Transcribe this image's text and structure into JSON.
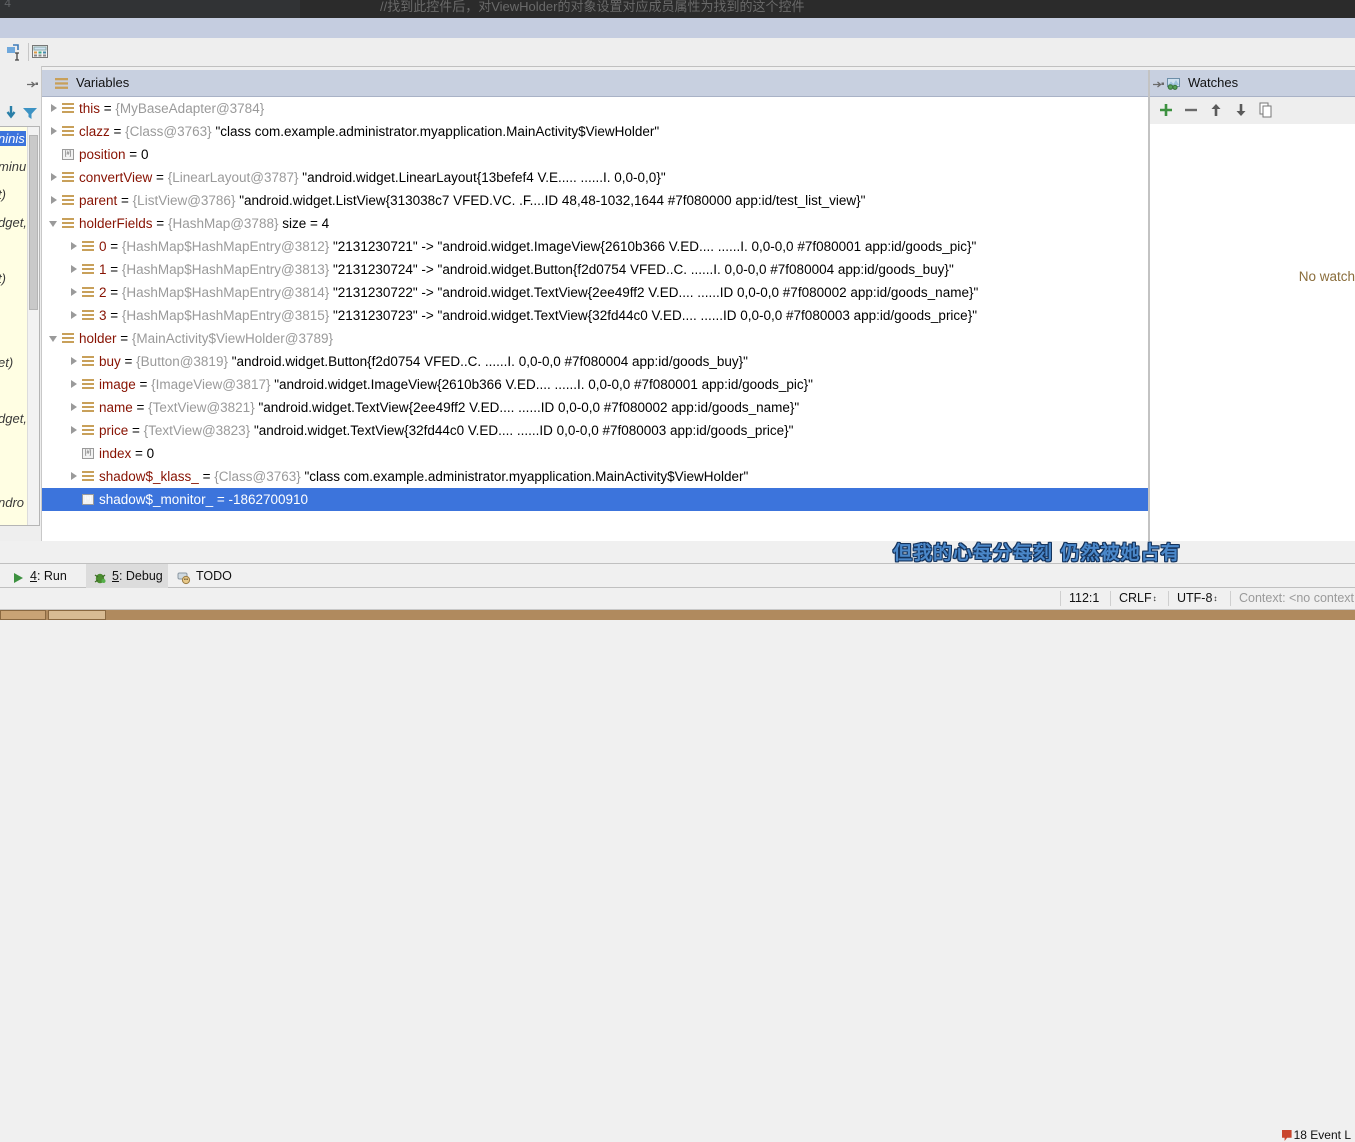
{
  "editor": {
    "line_number": "4",
    "comment": "//找到此控件后，对ViewHolder的对象设置对应成员属性为找到的这个控件"
  },
  "mini_toolbar": {
    "icons": [
      "evaluate-expression-icon",
      "calculator-icon"
    ]
  },
  "variables_panel": {
    "title": "Variables",
    "icon": "variables-icon",
    "rows": [
      {
        "indent": 0,
        "toggle": "right",
        "icon": "obj",
        "name": "this",
        "eq": " = ",
        "type": "{MyBaseAdapter@3784}",
        "value": ""
      },
      {
        "indent": 0,
        "toggle": "right",
        "icon": "obj",
        "name": "clazz",
        "eq": " = ",
        "type": "{Class@3763}",
        "value": "\"class com.example.administrator.myapplication.MainActivity$ViewHolder\""
      },
      {
        "indent": 0,
        "toggle": "none",
        "icon": "prim",
        "name": "position",
        "eq": " = ",
        "type": "",
        "value": "0"
      },
      {
        "indent": 0,
        "toggle": "right",
        "icon": "obj",
        "name": "convertView",
        "eq": " = ",
        "type": "{LinearLayout@3787}",
        "value": "\"android.widget.LinearLayout{13befef4 V.E..... ......I. 0,0-0,0}\""
      },
      {
        "indent": 0,
        "toggle": "right",
        "icon": "obj",
        "name": "parent",
        "eq": " = ",
        "type": "{ListView@3786}",
        "value": "\"android.widget.ListView{313038c7 VFED.VC. .F....ID 48,48-1032,1644 #7f080000 app:id/test_list_view}\""
      },
      {
        "indent": 0,
        "toggle": "down",
        "icon": "obj",
        "name": "holderFields",
        "eq": " = ",
        "type": "{HashMap@3788}",
        "value": "size = 4"
      },
      {
        "indent": 1,
        "toggle": "right",
        "icon": "obj",
        "name": "0",
        "eq": " = ",
        "type": "{HashMap$HashMapEntry@3812}",
        "value": "\"2131230721\" -> \"android.widget.ImageView{2610b366 V.ED.... ......I. 0,0-0,0 #7f080001 app:id/goods_pic}\""
      },
      {
        "indent": 1,
        "toggle": "right",
        "icon": "obj",
        "name": "1",
        "eq": " = ",
        "type": "{HashMap$HashMapEntry@3813}",
        "value": "\"2131230724\" -> \"android.widget.Button{f2d0754 VFED..C. ......I. 0,0-0,0 #7f080004 app:id/goods_buy}\""
      },
      {
        "indent": 1,
        "toggle": "right",
        "icon": "obj",
        "name": "2",
        "eq": " = ",
        "type": "{HashMap$HashMapEntry@3814}",
        "value": "\"2131230722\" -> \"android.widget.TextView{2ee49ff2 V.ED.... ......ID 0,0-0,0 #7f080002 app:id/goods_name}\""
      },
      {
        "indent": 1,
        "toggle": "right",
        "icon": "obj",
        "name": "3",
        "eq": " = ",
        "type": "{HashMap$HashMapEntry@3815}",
        "value": "\"2131230723\" -> \"android.widget.TextView{32fd44c0 V.ED.... ......ID 0,0-0,0 #7f080003 app:id/goods_price}\""
      },
      {
        "indent": 0,
        "toggle": "down",
        "icon": "obj",
        "name": "holder",
        "eq": " = ",
        "type": "{MainActivity$ViewHolder@3789}",
        "value": ""
      },
      {
        "indent": 1,
        "toggle": "right",
        "icon": "obj",
        "name": "buy",
        "eq": " = ",
        "type": "{Button@3819}",
        "value": "\"android.widget.Button{f2d0754 VFED..C. ......I. 0,0-0,0 #7f080004 app:id/goods_buy}\""
      },
      {
        "indent": 1,
        "toggle": "right",
        "icon": "obj",
        "name": "image",
        "eq": " = ",
        "type": "{ImageView@3817}",
        "value": "\"android.widget.ImageView{2610b366 V.ED.... ......I. 0,0-0,0 #7f080001 app:id/goods_pic}\""
      },
      {
        "indent": 1,
        "toggle": "right",
        "icon": "obj",
        "name": "name",
        "eq": " = ",
        "type": "{TextView@3821}",
        "value": "\"android.widget.TextView{2ee49ff2 V.ED.... ......ID 0,0-0,0 #7f080002 app:id/goods_name}\""
      },
      {
        "indent": 1,
        "toggle": "right",
        "icon": "obj",
        "name": "price",
        "eq": " = ",
        "type": "{TextView@3823}",
        "value": "\"android.widget.TextView{32fd44c0 V.ED.... ......ID 0,0-0,0 #7f080003 app:id/goods_price}\""
      },
      {
        "indent": 1,
        "toggle": "none",
        "icon": "prim",
        "name": "index",
        "eq": " = ",
        "type": "",
        "value": "0"
      },
      {
        "indent": 1,
        "toggle": "right",
        "icon": "obj",
        "name": "shadow$_klass_",
        "eq": " = ",
        "type": "{Class@3763}",
        "value": "\"class com.example.administrator.myapplication.MainActivity$ViewHolder\""
      },
      {
        "indent": 1,
        "toggle": "none",
        "icon": "prim",
        "name": "shadow$_monitor_",
        "eq": " = ",
        "type": "",
        "value": "-1862700910",
        "selected": true
      }
    ]
  },
  "watches_panel": {
    "title": "Watches",
    "icon": "watches-icon",
    "toolbar": [
      {
        "name": "add-watch-button",
        "glyph": "+"
      },
      {
        "name": "remove-watch-button",
        "glyph": "−"
      },
      {
        "name": "move-watch-up-button",
        "glyph": "↑"
      },
      {
        "name": "move-watch-down-button",
        "glyph": "↓"
      },
      {
        "name": "duplicate-watch-button",
        "glyph": "❐"
      }
    ],
    "empty_text": "No watch"
  },
  "completion_popup": {
    "lines": [
      "ninis",
      "minu",
      "t)",
      "dget,",
      "",
      "t)",
      "",
      "",
      "et)",
      "",
      "dget,",
      "",
      "",
      "ndro"
    ]
  },
  "lyric_overlay": {
    "text": "但我的心每分每刻 仍然被她占有"
  },
  "tool_tabs": [
    {
      "label_pre": "",
      "num": "4",
      "label": ": Run",
      "icon": "run-icon",
      "active": false
    },
    {
      "label_pre": "",
      "num": "5",
      "label": ": Debug",
      "icon": "debug-icon",
      "active": true
    },
    {
      "label_pre": "",
      "num": "",
      "label": "TODO",
      "icon": "todo-icon",
      "active": false
    }
  ],
  "event_log": {
    "count": "18",
    "label": "Event L"
  },
  "status_bar": {
    "caret": "112:1",
    "line_separator": "CRLF",
    "encoding": "UTF-8",
    "context": "Context: <no context"
  },
  "colors": {
    "selection": "#3c74dc",
    "panel_header": "#c8d0e0",
    "var_name": "#871202",
    "var_type": "#9a9a9a",
    "popup_bg": "#fffee3"
  }
}
